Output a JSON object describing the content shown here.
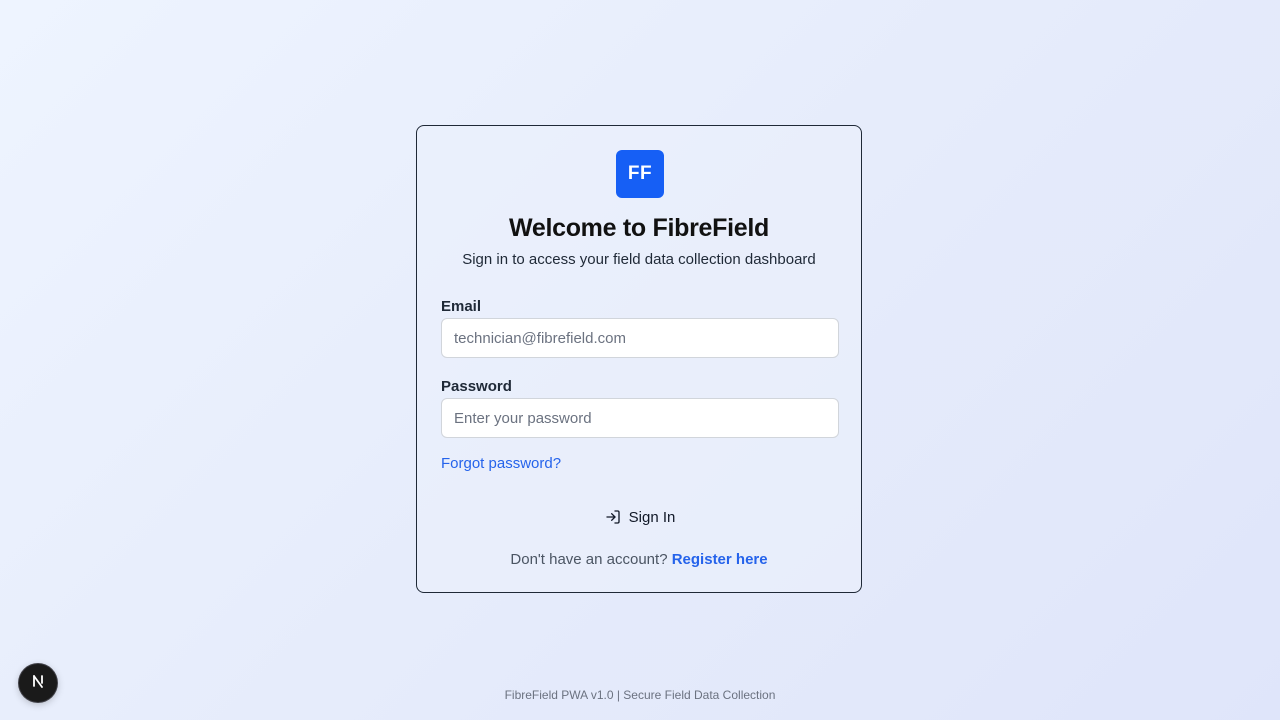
{
  "logo": {
    "text": "FF",
    "color": "#165ff5"
  },
  "header": {
    "title": "Welcome to FibreField",
    "subtitle": "Sign in to access your field data collection dashboard"
  },
  "form": {
    "email_label": "Email",
    "email_placeholder": "technician@fibrefield.com",
    "email_value": "",
    "password_label": "Password",
    "password_placeholder": "Enter your password",
    "password_value": "",
    "forgot_label": "Forgot password?",
    "signin_label": "Sign In",
    "signin_icon": "log-in-icon"
  },
  "register": {
    "prompt": "Don't have an account?",
    "link_label": "Register here"
  },
  "footer": {
    "text": "FibreField PWA v1.0 | Secure Field Data Collection"
  },
  "dev_badge": {
    "icon": "nextjs-logo-icon",
    "letter": "N"
  },
  "colors": {
    "accent": "#2563eb",
    "brand": "#165ff5"
  }
}
